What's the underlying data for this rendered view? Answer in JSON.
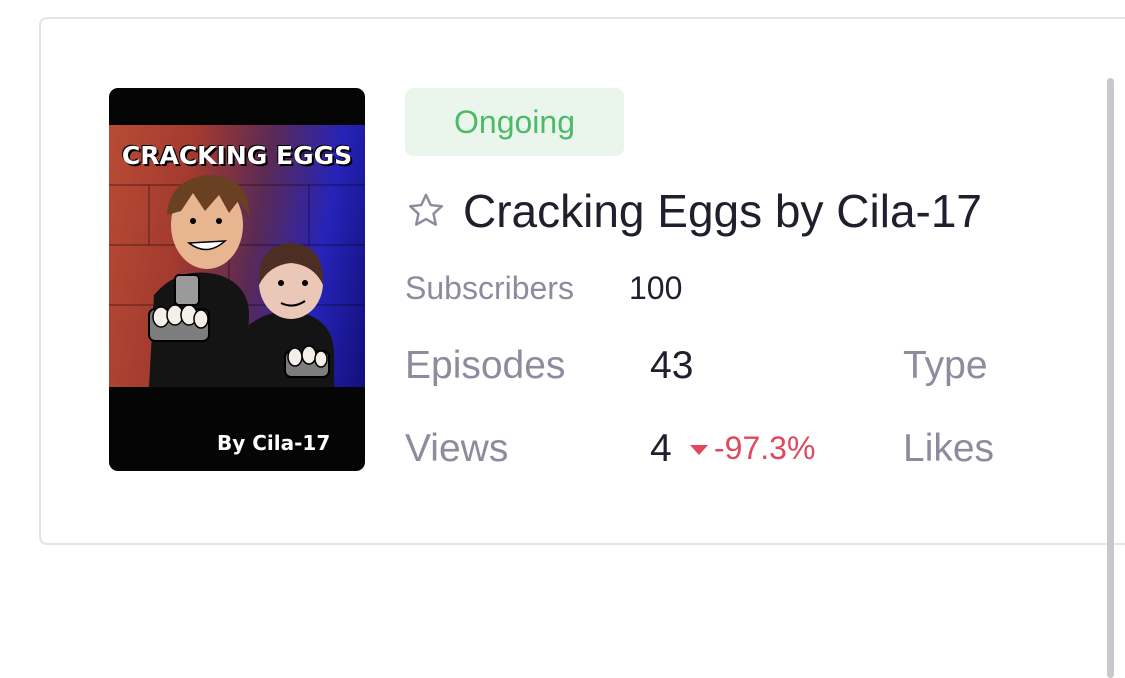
{
  "status_badge": "Ongoing",
  "series": {
    "title": "Cracking Eggs by Cila-17",
    "favorite_icon": "star-outline-icon"
  },
  "cover": {
    "title_text": "CRACKING EGGS",
    "byline_text": "By Cila-17"
  },
  "stats": {
    "subscribers_label": "Subscribers",
    "subscribers_value": "100",
    "episodes_label": "Episodes",
    "episodes_value": "43",
    "type_label": "Type",
    "views_label": "Views",
    "views_value": "4",
    "views_delta": "-97.3%",
    "views_delta_icon": "caret-down-icon",
    "likes_label": "Likes"
  },
  "colors": {
    "ongoing_green": "#4dba69",
    "ongoing_bg": "#eaf6ec",
    "delta_red": "#e0485b",
    "label_gray": "#8c8c9e",
    "text_dark": "#1f1f2e"
  }
}
